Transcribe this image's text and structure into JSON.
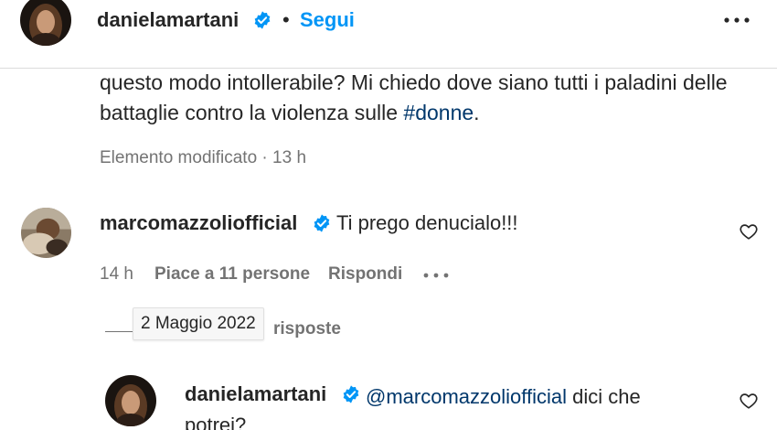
{
  "post": {
    "author": "danielamartani",
    "follow_label": "Segui",
    "separator": "•",
    "more_icon": "more-horizontal-icon"
  },
  "caption": {
    "text_before": "questo modo intollerabile? Mi chiedo dove siano tutti i paladini delle battaglie contro la violenza sulle ",
    "hashtag": "#donne",
    "text_after": ".",
    "meta": "Elemento modificato · 13 h"
  },
  "comment": {
    "username": "marcomazzoliofficial",
    "text": "Ti prego denucialo!!!",
    "time": "14 h",
    "likes": "Piace a 11 persone",
    "reply_label": "Rispondi",
    "more_icon": "more-horizontal-icon",
    "like_icon": "heart-outline-icon"
  },
  "replies": {
    "tail_label": "risposte",
    "tooltip_date": "2 Maggio 2022"
  },
  "reply": {
    "username": "danielamartani",
    "mention": "@marcomazzoliofficial",
    "text": " dici che potrei?",
    "like_icon": "heart-outline-icon"
  },
  "colors": {
    "link_blue": "#0095f6",
    "hashtag_blue": "#00376b",
    "secondary_text": "#737373",
    "verified_blue": "#0095f6"
  }
}
